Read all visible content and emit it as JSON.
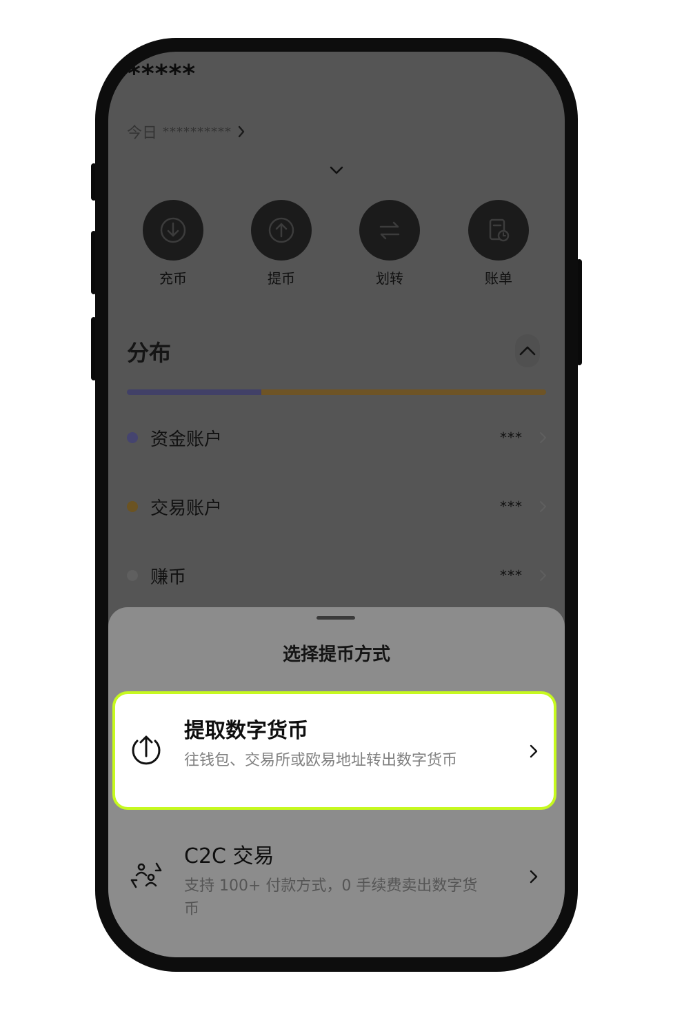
{
  "header": {
    "masked_balance": "*****",
    "today_label": "今日",
    "today_value": "**********"
  },
  "actions": [
    {
      "label": "充币",
      "icon": "deposit-icon"
    },
    {
      "label": "提币",
      "icon": "withdraw-icon"
    },
    {
      "label": "划转",
      "icon": "transfer-icon"
    },
    {
      "label": "账单",
      "icon": "bill-icon"
    }
  ],
  "distribution": {
    "title": "分布",
    "bar_segments": [
      {
        "account": "资金账户",
        "fraction": 0.32,
        "color": "#414067"
      },
      {
        "account": "交易账户",
        "fraction": 0.68,
        "color": "#6e5426"
      }
    ],
    "accounts": [
      {
        "name": "资金账户",
        "value": "***",
        "color": "#45446f"
      },
      {
        "name": "交易账户",
        "value": "***",
        "color": "#6b5322"
      },
      {
        "name": "赚币",
        "value": "***",
        "color": "#5f5f5f"
      }
    ]
  },
  "sheet": {
    "title": "选择提币方式",
    "options": [
      {
        "title": "提取数字货币",
        "desc": "往钱包、交易所或欧易地址转出数字货币",
        "icon": "upload-icon",
        "selected": true
      },
      {
        "title": "C2C 交易",
        "desc": "支持 100+ 付款方式，0 手续费卖出数字货币",
        "icon": "c2c-exchange-icon",
        "selected": false
      }
    ]
  },
  "colors": {
    "highlight": "#c6f91f",
    "overlay_dim": "#555555"
  }
}
